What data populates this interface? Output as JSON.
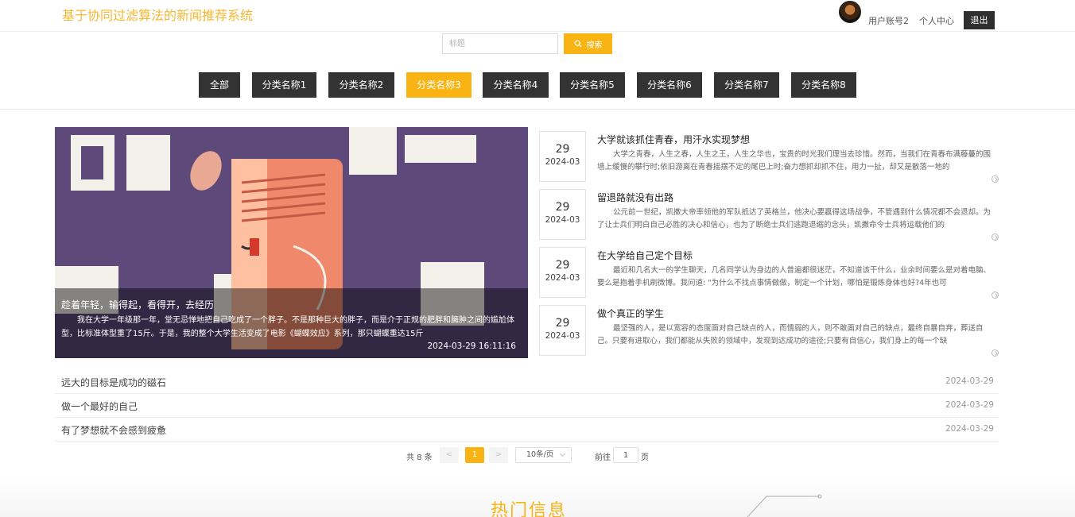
{
  "header": {
    "site_title": "基于协同过滤算法的新闻推荐系统",
    "user_name": "用户账号2",
    "user_center": "个人中心",
    "logout": "退出"
  },
  "search": {
    "placeholder": "标题",
    "button_label": "搜索"
  },
  "categories": [
    {
      "label": "全部",
      "active": false
    },
    {
      "label": "分类名称1",
      "active": false
    },
    {
      "label": "分类名称2",
      "active": false
    },
    {
      "label": "分类名称3",
      "active": true
    },
    {
      "label": "分类名称4",
      "active": false
    },
    {
      "label": "分类名称5",
      "active": false
    },
    {
      "label": "分类名称6",
      "active": false
    },
    {
      "label": "分类名称7",
      "active": false
    },
    {
      "label": "分类名称8",
      "active": false
    }
  ],
  "banner": {
    "title": "趁着年轻，输得起，看得开，去经历",
    "description": "我在大学一年级那一年，堂无忌惮地把自己吃成了一个胖子。不是那种巨大的胖子，而是介于正规的肥胖和臃肿之间的尴尬体型，比标准体型重了15斤。于是，我的整个大学生活变成了电影《蝴蝶效应》系列，那只蝴蝶重达15斤",
    "time": "2024-03-29 16:11:16"
  },
  "news": [
    {
      "day": "29",
      "ym": "2024-03",
      "title": "大学就该抓住青春，用汗水实现梦想",
      "summary": "大学之青春，人生之春，人生之王，人生之华也，宝贵的时光我们理当去珍惜。然而，当我们在青春布满藤蔓的围墙上缓慢的攀行时;依旧游离在青春摇摆不定的尾巴上时;奋力想抓却抓不住，用力一扯，却又是散落一地的"
    },
    {
      "day": "29",
      "ym": "2024-03",
      "title": "留退路就没有出路",
      "summary": "公元前一世纪，凯撒大帝率领他的军队抵达了英格兰，他决心要赢得这场战争，不管遇到什么情况都不会退却。为了让士兵们明白自己必胜的决心和信心，也为了断绝士兵们逃跑退缩的念头，凯撒命令士兵将运载他们的"
    },
    {
      "day": "29",
      "ym": "2024-03",
      "title": "在大学给自己定个目标",
      "summary": "最近和几名大一的学生聊天，几名同学认为身边的人普遍都很迷茫，不知道该干什么，业余时间要么是对着电脑、要么是抱着手机刷微博。我问道: \"为什么不找点事情做做，制定一个计划，哪怕是锻炼身体也好?4年也可"
    },
    {
      "day": "29",
      "ym": "2024-03",
      "title": "做个真正的学生",
      "summary": "最坚强的人，是以宽容的态度面对自己缺点的人，而懦弱的人，则不敢面对自己的缺点，最终自暴自弃，葬送自己。只要有进取心，我们都能从失败的领域中，发现到达成功的途径;只要有自信心，我们身上的每一个缺"
    }
  ],
  "list": [
    {
      "title": "远大的目标是成功的磁石",
      "date": "2024-03-29"
    },
    {
      "title": "做一个最好的自己",
      "date": "2024-03-29"
    },
    {
      "title": "有了梦想就不会感到疲惫",
      "date": "2024-03-29"
    }
  ],
  "pagination": {
    "total": "共 8 条",
    "prev": "<",
    "current": "1",
    "next": ">",
    "page_size": "10条/页",
    "goto_label": "前往",
    "goto_value": "1",
    "page_unit": "页"
  },
  "hot": {
    "title": "热门信息"
  },
  "colors": {
    "accent": "#f9b313",
    "dark_button": "#333333",
    "title_yellow": "#f7b731"
  }
}
